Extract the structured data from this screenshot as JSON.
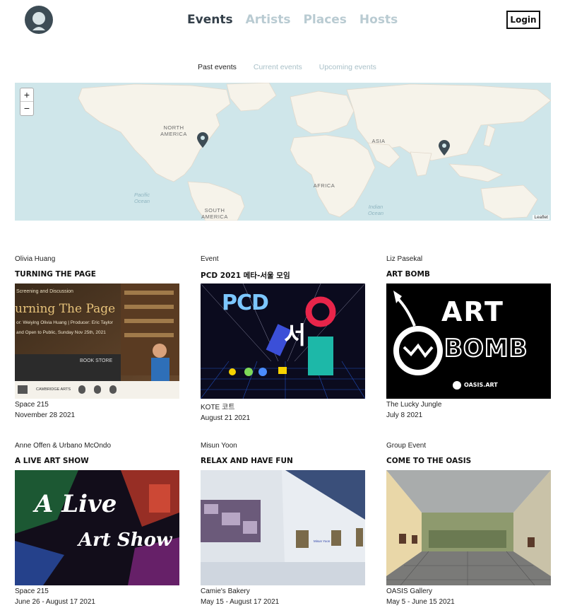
{
  "header": {
    "nav": [
      "Events",
      "Artists",
      "Places",
      "Hosts"
    ],
    "login_label": "Login"
  },
  "subtabs": [
    "Past events",
    "Current events",
    "Upcoming events"
  ],
  "map": {
    "labels": [
      "NORTH AMERICA",
      "ASIA",
      "AFRICA",
      "SOUTH AMERICA"
    ],
    "oceans": [
      "Pacific Ocean",
      "Indian Ocean"
    ],
    "zoom_in": "+",
    "zoom_out": "−",
    "attribution": "Leaflet"
  },
  "events": [
    {
      "host": "Olivia Huang",
      "title": "TURNING THE PAGE",
      "place": "Space 215",
      "date": "November 28 2021",
      "thumb_text": {
        "line1": "Screening and Discussion",
        "line2": "urning The Page",
        "line3": "or: Weiying Olivia Huang | Producer: Eric Taylor",
        "line4": "and Open to Public, Sunday Nov 25th, 2021",
        "line5": "BOOK STORE",
        "line6": "CAMBRIDGE ARTS"
      }
    },
    {
      "host": "Event",
      "title": "PCD 2021 메타-서울 모임",
      "place": "KOTE 코트",
      "date": "August 21 2021",
      "thumb_text": {
        "line1": "PCD",
        "line2": "서"
      }
    },
    {
      "host": "Liz Pasekal",
      "title": "ART BOMB",
      "place": "The Lucky Jungle",
      "date": "July 8 2021",
      "thumb_text": {
        "line1": "ART",
        "line2": "BOMB",
        "line3": "OASIS.ART"
      }
    },
    {
      "host": "Anne Offen & Urbano McOndo",
      "title": "A LIVE ART SHOW",
      "place": "Space 215",
      "date": "June 26 - August 17 2021",
      "thumb_text": {
        "line1": "A Live",
        "line2": "Art Show"
      }
    },
    {
      "host": "Misun Yoon",
      "title": "RELAX AND HAVE FUN",
      "place": "Camie's Bakery",
      "date": "May 15 - August 17 2021",
      "thumb_text": {
        "line1": "Misun Yoon"
      }
    },
    {
      "host": "Group Event",
      "title": "COME TO THE OASIS",
      "place": "OASIS Gallery",
      "date": "May 5 - June 15 2021",
      "thumb_text": {}
    }
  ],
  "colors": {
    "nav_active": "#34404a",
    "nav_inactive": "#b9cbd2",
    "map_water": "#cfe6ea",
    "map_land": "#f6f3ea",
    "pin": "#3d4c55"
  }
}
